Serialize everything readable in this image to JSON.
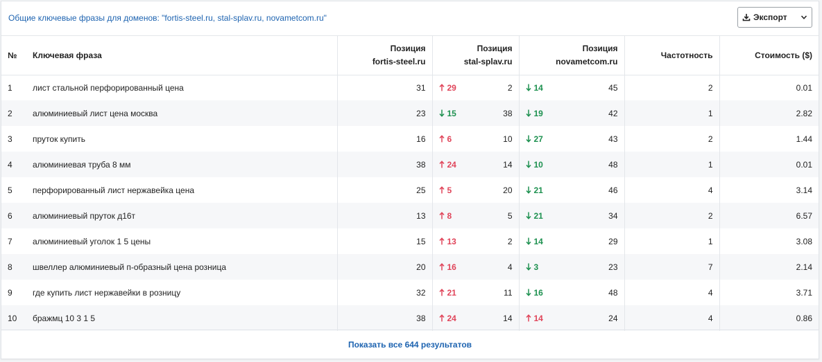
{
  "panel": {
    "title": "Общие ключевые фразы для доменов: \"fortis-steel.ru, stal-splav.ru, novametcom.ru\"",
    "export_label": "Экспорт",
    "accent_color": "#1d63b0",
    "up_color": "#e0455a",
    "down_color": "#1e9150"
  },
  "table": {
    "headers": {
      "no": "№",
      "keyword": "Ключевая фраза",
      "pos1_line1": "Позиция",
      "pos1_line2": "fortis-steel.ru",
      "pos2_line1": "Позиция",
      "pos2_line2": "stal-splav.ru",
      "pos3_line1": "Позиция",
      "pos3_line2": "novametcom.ru",
      "frequency": "Частотность",
      "cost": "Стоимость ($)"
    },
    "rows": [
      {
        "no": "1",
        "keyword": "лист стальной перфорированный цена",
        "pos1": "31",
        "d2": "29",
        "d2dir": "up",
        "pos2": "2",
        "d3": "14",
        "d3dir": "down",
        "pos3": "45",
        "freq": "2",
        "cost": "0.01"
      },
      {
        "no": "2",
        "keyword": "алюминиевый лист цена москва",
        "pos1": "23",
        "d2": "15",
        "d2dir": "down",
        "pos2": "38",
        "d3": "19",
        "d3dir": "down",
        "pos3": "42",
        "freq": "1",
        "cost": "2.82"
      },
      {
        "no": "3",
        "keyword": "пруток купить",
        "pos1": "16",
        "d2": "6",
        "d2dir": "up",
        "pos2": "10",
        "d3": "27",
        "d3dir": "down",
        "pos3": "43",
        "freq": "2",
        "cost": "1.44"
      },
      {
        "no": "4",
        "keyword": "алюминиевая труба 8 мм",
        "pos1": "38",
        "d2": "24",
        "d2dir": "up",
        "pos2": "14",
        "d3": "10",
        "d3dir": "down",
        "pos3": "48",
        "freq": "1",
        "cost": "0.01"
      },
      {
        "no": "5",
        "keyword": "перфорированный лист нержавейка цена",
        "pos1": "25",
        "d2": "5",
        "d2dir": "up",
        "pos2": "20",
        "d3": "21",
        "d3dir": "down",
        "pos3": "46",
        "freq": "4",
        "cost": "3.14"
      },
      {
        "no": "6",
        "keyword": "алюминиевый пруток д16т",
        "pos1": "13",
        "d2": "8",
        "d2dir": "up",
        "pos2": "5",
        "d3": "21",
        "d3dir": "down",
        "pos3": "34",
        "freq": "2",
        "cost": "6.57"
      },
      {
        "no": "7",
        "keyword": "алюминиевый уголок 1 5 цены",
        "pos1": "15",
        "d2": "13",
        "d2dir": "up",
        "pos2": "2",
        "d3": "14",
        "d3dir": "down",
        "pos3": "29",
        "freq": "1",
        "cost": "3.08"
      },
      {
        "no": "8",
        "keyword": "швеллер алюминиевый п-образный цена розница",
        "pos1": "20",
        "d2": "16",
        "d2dir": "up",
        "pos2": "4",
        "d3": "3",
        "d3dir": "down",
        "pos3": "23",
        "freq": "7",
        "cost": "2.14"
      },
      {
        "no": "9",
        "keyword": "где купить лист нержавейки в розницу",
        "pos1": "32",
        "d2": "21",
        "d2dir": "up",
        "pos2": "11",
        "d3": "16",
        "d3dir": "down",
        "pos3": "48",
        "freq": "4",
        "cost": "3.71"
      },
      {
        "no": "10",
        "keyword": "бражмц 10 3 1 5",
        "pos1": "38",
        "d2": "24",
        "d2dir": "up",
        "pos2": "14",
        "d3": "14",
        "d3dir": "up",
        "pos3": "24",
        "freq": "4",
        "cost": "0.86"
      }
    ]
  },
  "footer": {
    "show_all_label": "Показать все 644 результатов"
  }
}
